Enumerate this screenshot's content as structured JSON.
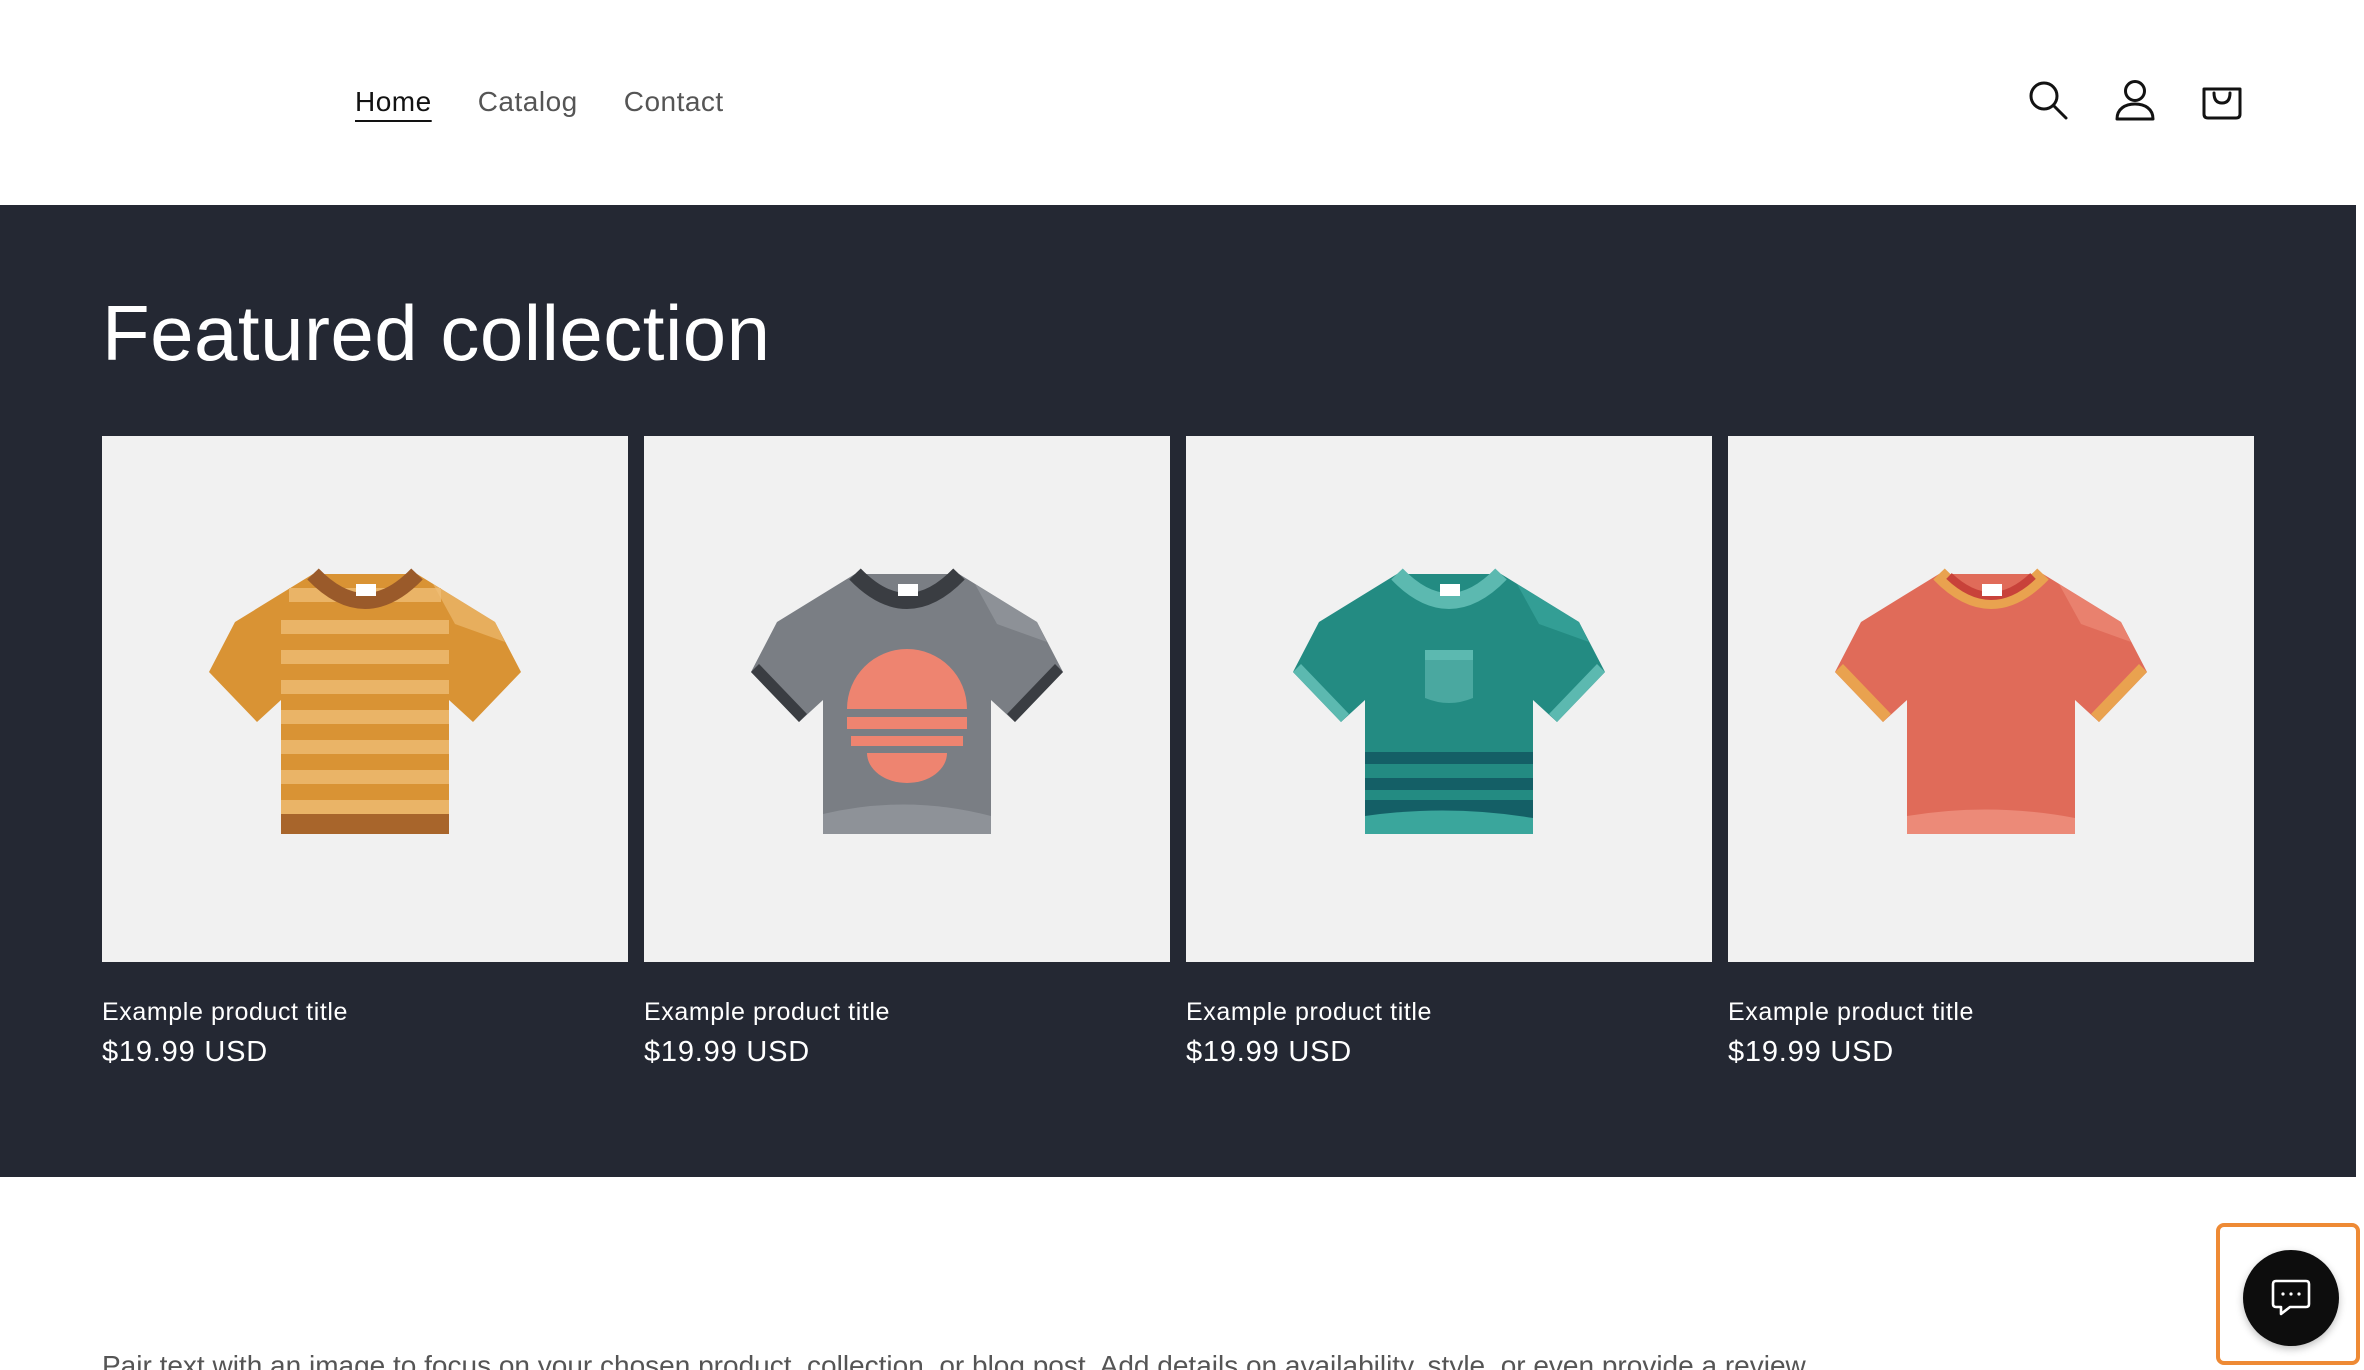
{
  "header": {
    "nav": [
      {
        "label": "Home",
        "active": true
      },
      {
        "label": "Catalog",
        "active": false
      },
      {
        "label": "Contact",
        "active": false
      }
    ],
    "icons": [
      "search-icon",
      "account-icon",
      "cart-icon"
    ]
  },
  "featured": {
    "title": "Featured collection",
    "background": "#242833",
    "products": [
      {
        "title": "Example product title",
        "price": "$19.99 USD",
        "image": "striped-orange-tshirt"
      },
      {
        "title": "Example product title",
        "price": "$19.99 USD",
        "image": "grey-sunset-tshirt"
      },
      {
        "title": "Example product title",
        "price": "$19.99 USD",
        "image": "teal-pocket-tshirt"
      },
      {
        "title": "Example product title",
        "price": "$19.99 USD",
        "image": "coral-ringer-tshirt"
      }
    ]
  },
  "below": {
    "text": "Pair text with an image to focus on your chosen product, collection, or blog post. Add details on availability, style, or even provide a review."
  },
  "chat": {
    "icon": "chat-icon",
    "highlight_color": "#ee8a35"
  }
}
